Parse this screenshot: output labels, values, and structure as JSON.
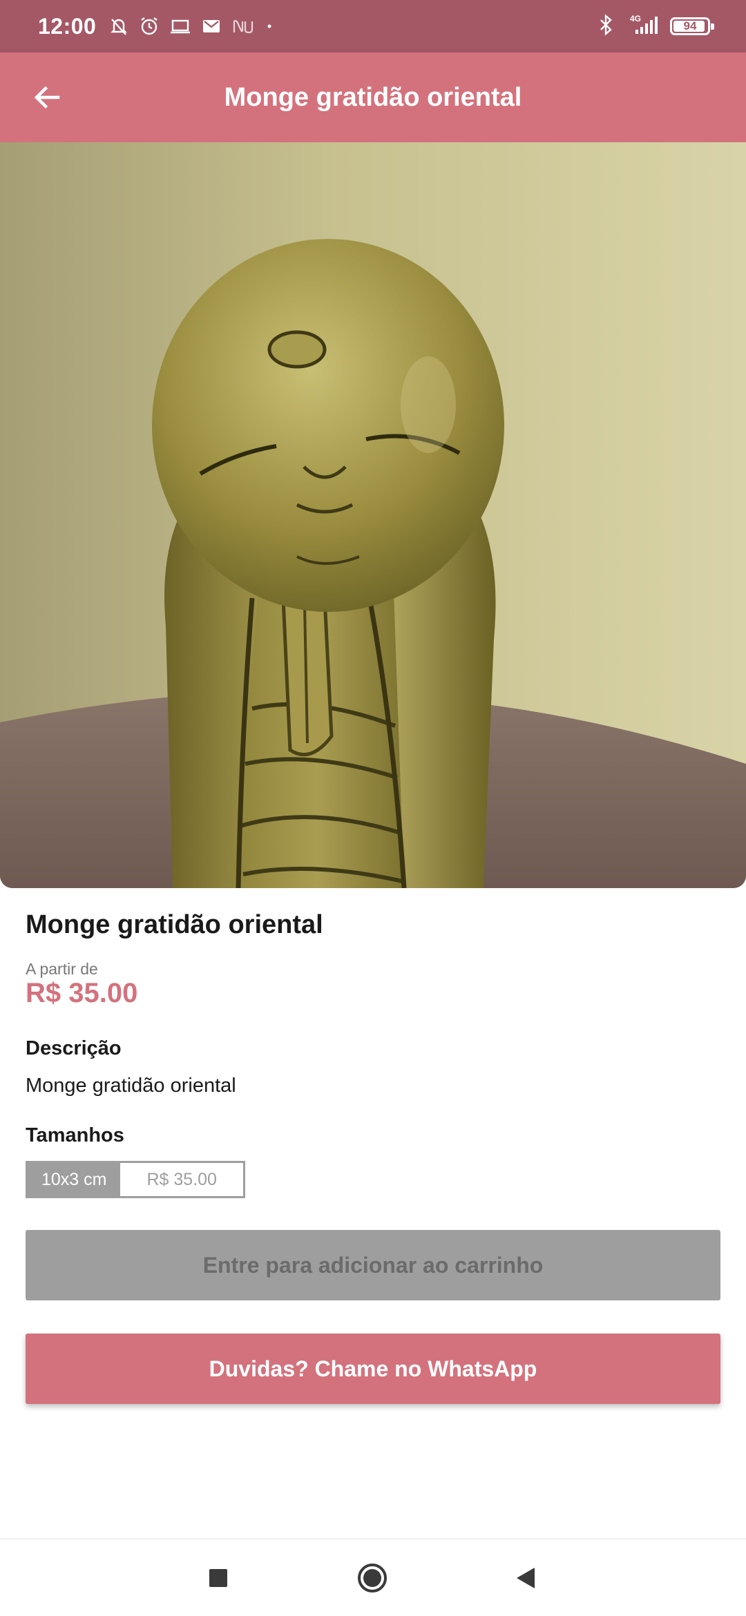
{
  "status_bar": {
    "time": "12:00",
    "battery": "94",
    "network": "4G"
  },
  "app_bar": {
    "title": "Monge gratidão oriental",
    "back_icon": "arrow-left-icon"
  },
  "carousel": {
    "image_description_icon": "product-photo",
    "dots": 1,
    "active_dot": 1
  },
  "product": {
    "name": "Monge gratidão oriental",
    "price_prefix": "A partir de",
    "price": "R$ 35.00",
    "description_heading": "Descrição",
    "description": "Monge gratidão oriental",
    "sizes_heading": "Tamanhos",
    "sizes": [
      {
        "label": "10x3 cm",
        "price": "R$ 35.00"
      }
    ]
  },
  "actions": {
    "cart_button": "Entre para adicionar ao carrinho",
    "whatsapp_button": "Duvidas? Chame no WhatsApp"
  },
  "colors": {
    "primary": "#d3727d",
    "status_bar": "#a45866",
    "disabled": "#9e9e9e"
  }
}
